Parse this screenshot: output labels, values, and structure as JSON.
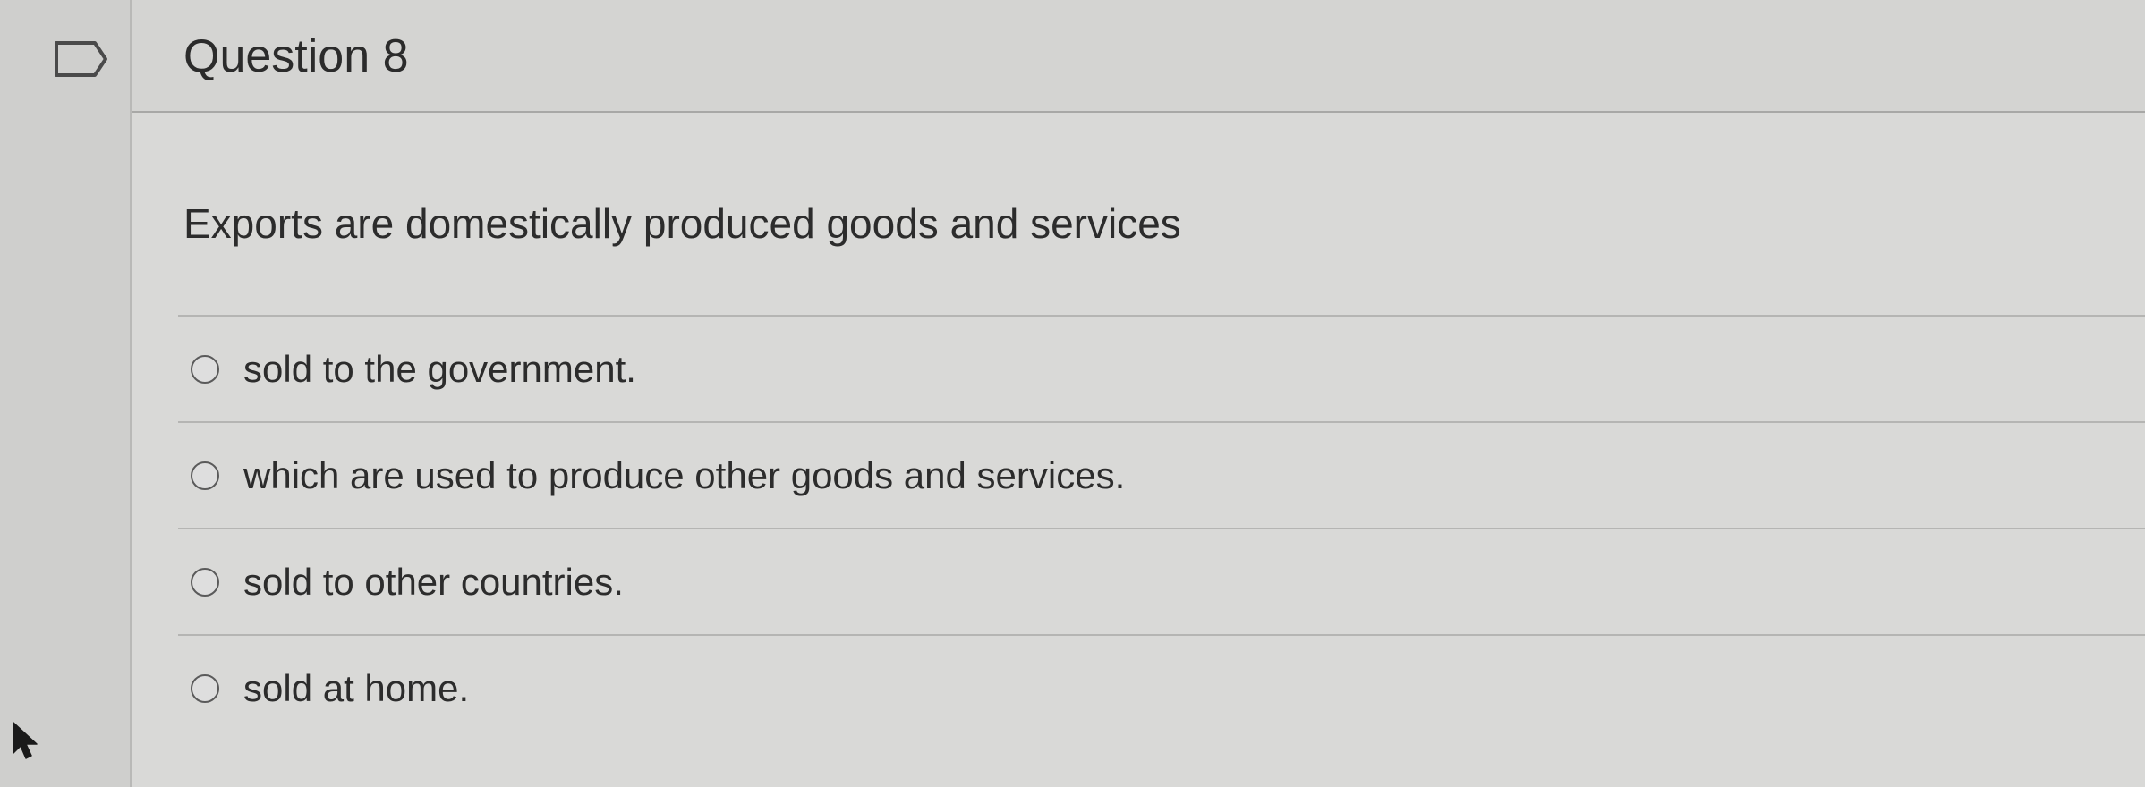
{
  "question": {
    "title": "Question 8",
    "text": "Exports are domestically produced goods and services"
  },
  "answers": [
    {
      "label": "sold to the government."
    },
    {
      "label": "which are used to produce other goods and services."
    },
    {
      "label": "sold to other countries."
    },
    {
      "label": "sold at home."
    }
  ],
  "icons": {
    "flag": "flag-outline-icon",
    "cursor": "mouse-pointer-icon"
  },
  "colors": {
    "page_background": "#d3d3d1",
    "text": "#2c2c2c"
  }
}
